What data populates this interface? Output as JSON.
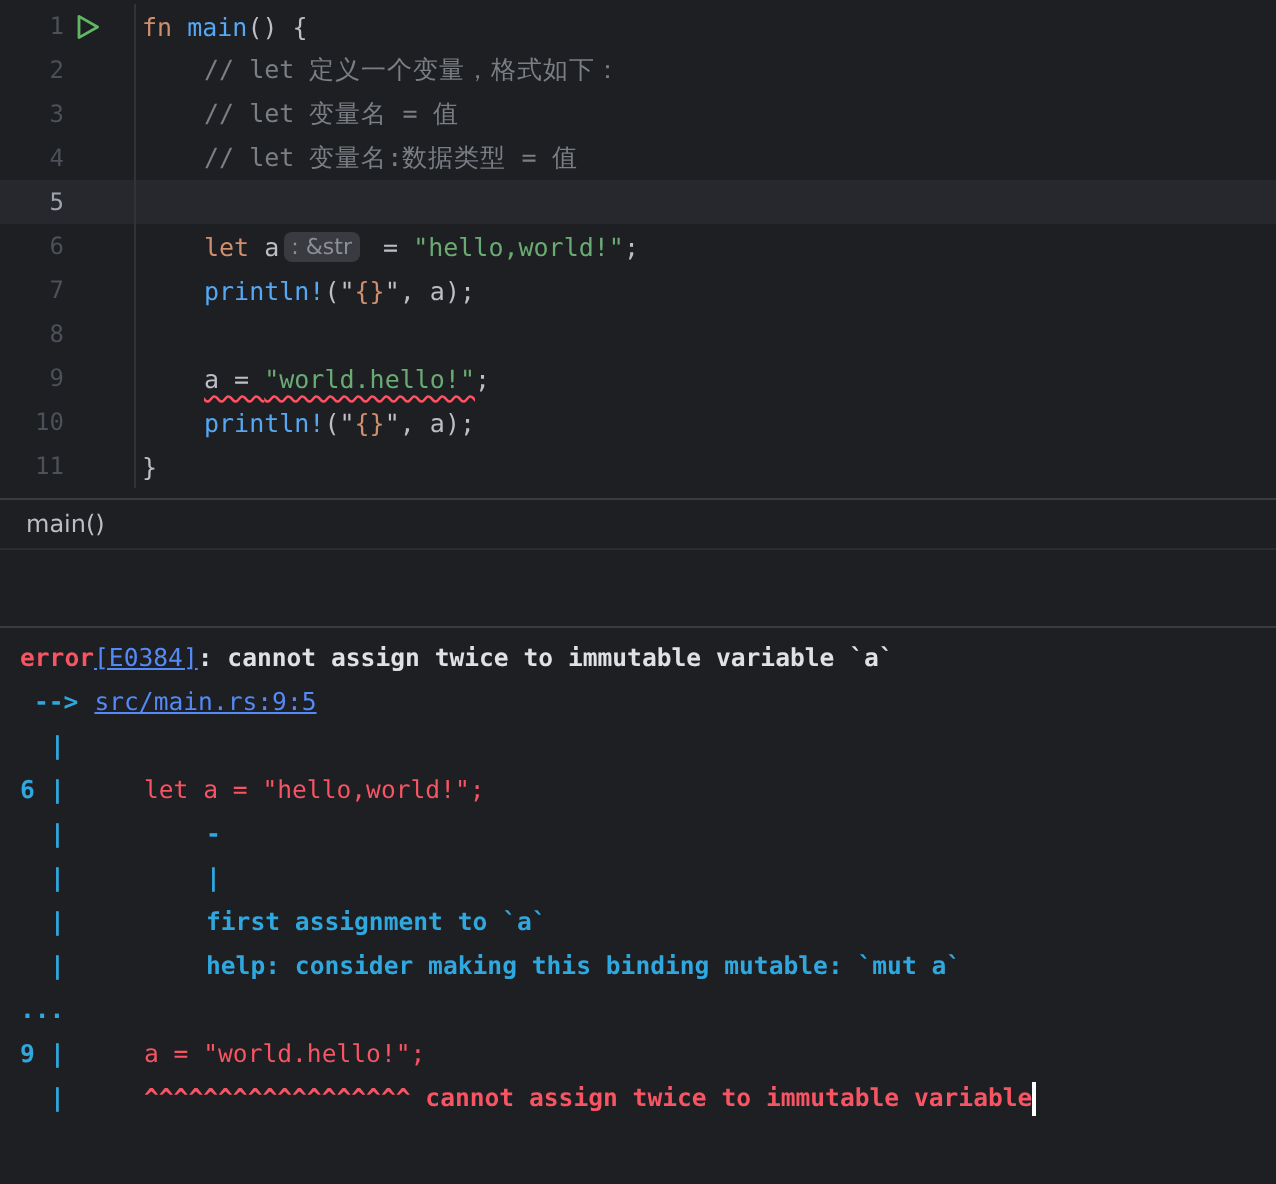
{
  "editor": {
    "lines": [
      {
        "number": "1",
        "current": false,
        "run": true,
        "tokens": [
          {
            "text": "fn ",
            "kind": "keyword"
          },
          {
            "text": "main",
            "kind": "function"
          },
          {
            "text": "() {",
            "kind": "plain"
          }
        ]
      },
      {
        "number": "2",
        "current": false,
        "indented": true,
        "tokens": [
          {
            "text": "// let 定义一个变量，格式如下：",
            "kind": "comment"
          }
        ]
      },
      {
        "number": "3",
        "current": false,
        "indented": true,
        "tokens": [
          {
            "text": "// let 变量名 = 值",
            "kind": "comment"
          }
        ]
      },
      {
        "number": "4",
        "current": false,
        "indented": true,
        "tokens": [
          {
            "text": "// let 变量名:数据类型 = 值",
            "kind": "comment"
          }
        ]
      },
      {
        "number": "5",
        "current": true
      },
      {
        "number": "6",
        "current": false,
        "indented": true,
        "tokens": [
          {
            "text": "let",
            "kind": "keyword"
          },
          {
            "text": " a",
            "kind": "plain"
          },
          {
            "text": ": &str",
            "kind": "hint"
          },
          {
            "text": " = ",
            "kind": "plain"
          },
          {
            "text": "\"hello,world!\"",
            "kind": "string"
          },
          {
            "text": ";",
            "kind": "plain"
          }
        ]
      },
      {
        "number": "7",
        "current": false,
        "indented": true,
        "tokens": [
          {
            "text": "println!",
            "kind": "macro"
          },
          {
            "text": "(\"",
            "kind": "plain"
          },
          {
            "text": "{}",
            "kind": "format"
          },
          {
            "text": "\", a);",
            "kind": "plain"
          }
        ]
      },
      {
        "number": "8",
        "current": false
      },
      {
        "number": "9",
        "current": false,
        "indented": true,
        "tokens": [
          {
            "text": "a = ",
            "kind": "plain",
            "squiggle": true
          },
          {
            "text": "\"world.hello!\"",
            "kind": "string",
            "squiggle": true
          },
          {
            "text": ";",
            "kind": "plain"
          }
        ]
      },
      {
        "number": "10",
        "current": false,
        "indented": true,
        "tokens": [
          {
            "text": "println!",
            "kind": "macro"
          },
          {
            "text": "(\"",
            "kind": "plain"
          },
          {
            "text": "{}",
            "kind": "format"
          },
          {
            "text": "\", a);",
            "kind": "plain"
          }
        ]
      },
      {
        "number": "11",
        "current": false,
        "tokens": [
          {
            "text": "}",
            "kind": "plain"
          }
        ]
      }
    ]
  },
  "breadcrumb": "main()",
  "console": {
    "lines": [
      {
        "kind": "header",
        "segments": [
          {
            "text": "error",
            "kind": "error"
          },
          {
            "text": "[E0384]",
            "kind": "link"
          },
          {
            "text": ": cannot assign twice to immutable variable `a`",
            "kind": "message"
          }
        ]
      },
      {
        "kind": "location",
        "segments": [
          {
            "text": "-->",
            "kind": "arrow"
          },
          {
            "text": "src/main.rs:9:5",
            "kind": "link"
          }
        ]
      },
      {
        "kind": "gutter",
        "bar": "|"
      },
      {
        "kind": "source",
        "number": "6",
        "bar": "|",
        "segments": [
          {
            "text": "let a = \"hello,world!\";",
            "kind": "source"
          }
        ]
      },
      {
        "kind": "note",
        "bar": "|",
        "segments": [
          {
            "text": "-",
            "kind": "note"
          }
        ]
      },
      {
        "kind": "note",
        "bar": "|",
        "segments": [
          {
            "text": "|",
            "kind": "note"
          }
        ]
      },
      {
        "kind": "note",
        "bar": "|",
        "segments": [
          {
            "text": "first assignment to `a`",
            "kind": "note"
          }
        ]
      },
      {
        "kind": "note",
        "bar": "|",
        "segments": [
          {
            "text": "help: consider making this binding mutable: `mut a`",
            "kind": "note"
          }
        ]
      },
      {
        "kind": "ellipsis",
        "segments": [
          {
            "text": "...",
            "kind": "arrow"
          }
        ]
      },
      {
        "kind": "source",
        "number": "9",
        "bar": "|",
        "segments": [
          {
            "text": "a = \"world.hello!\";",
            "kind": "source"
          }
        ]
      },
      {
        "kind": "source",
        "bar": "|",
        "cursor": true,
        "segments": [
          {
            "text": "^^^^^^^^^^^^^^^^^^ cannot assign twice to immutable variable",
            "kind": "label"
          }
        ]
      }
    ]
  }
}
